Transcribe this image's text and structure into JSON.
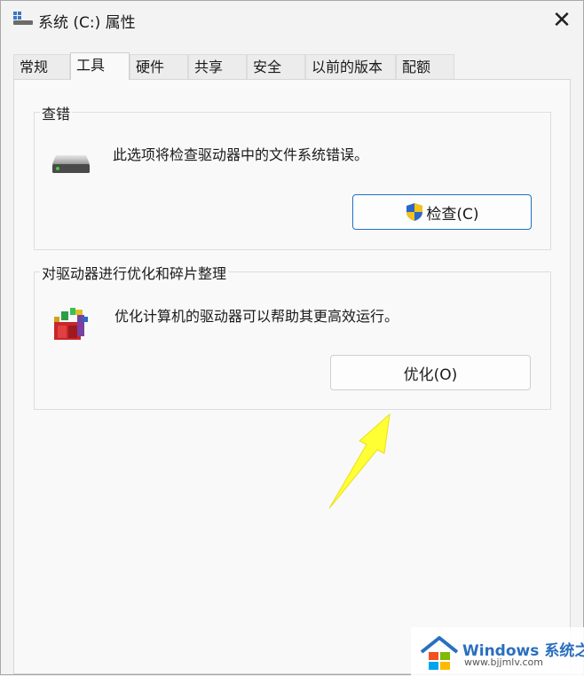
{
  "window": {
    "title": "系统 (C:) 属性",
    "close_glyph": "✕"
  },
  "tabs": [
    {
      "label": "常规",
      "active": false
    },
    {
      "label": "工具",
      "active": true
    },
    {
      "label": "硬件",
      "active": false
    },
    {
      "label": "共享",
      "active": false
    },
    {
      "label": "安全",
      "active": false
    },
    {
      "label": "以前的版本",
      "active": false
    },
    {
      "label": "配额",
      "active": false
    }
  ],
  "error_check": {
    "title": "查错",
    "description": "此选项将检查驱动器中的文件系统错误。",
    "button_label": "检查(C)",
    "icon": "hard-drive-icon",
    "button_icon": "uac-shield-icon"
  },
  "optimize": {
    "title": "对驱动器进行优化和碎片整理",
    "description": "优化计算机的驱动器可以帮助其更高效运行。",
    "button_label": "优化(O)",
    "icon": "defrag-icon"
  },
  "annotation": {
    "arrow_color": "#ffff33"
  },
  "watermark": {
    "brand": "Windows",
    "brand_cn": "系统之家",
    "url": "www.bjjmlv.com"
  },
  "colors": {
    "accent_border": "#1f6fc5"
  }
}
